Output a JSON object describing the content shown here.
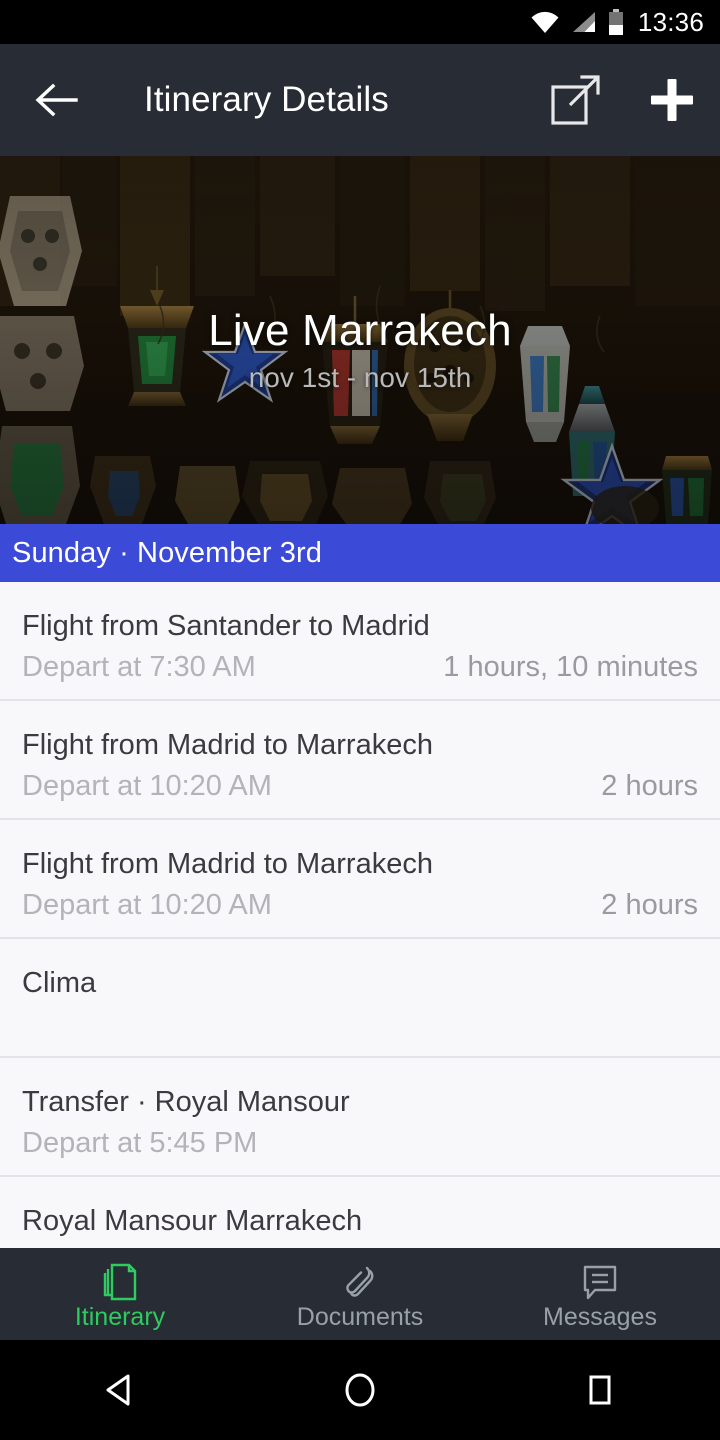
{
  "status_bar": {
    "time": "13:36",
    "icons": [
      "wifi-icon",
      "cellular-signal-icon",
      "battery-icon"
    ]
  },
  "app_bar": {
    "title": "Itinerary Details",
    "back_icon": "arrow-left-icon",
    "share_icon": "external-link-icon",
    "add_icon": "plus-icon"
  },
  "hero": {
    "title": "Live Marrakech",
    "subtitle": "nov 1st - nov 15th",
    "image_description": "moroccan-lanterns-photo"
  },
  "date_header": {
    "label": "Sunday · November 3rd",
    "color": "#3c4ad8"
  },
  "items": [
    {
      "title": "Flight from Santander to Madrid",
      "subtitle": "Depart at 7:30 AM",
      "meta": "1 hours, 10 minutes"
    },
    {
      "title": "Flight from Madrid to Marrakech",
      "subtitle": "Depart at 10:20 AM",
      "meta": "2 hours"
    },
    {
      "title": "Flight from Madrid to Marrakech",
      "subtitle": "Depart at 10:20 AM",
      "meta": "2 hours"
    },
    {
      "title": "Clima",
      "subtitle": "",
      "meta": ""
    },
    {
      "title": "Transfer · Royal Mansour",
      "subtitle": "Depart at 5:45 PM",
      "meta": ""
    },
    {
      "title": "Royal Mansour Marrakech",
      "subtitle": "",
      "meta": ""
    }
  ],
  "bottom_nav": {
    "active_color": "#2ecc5f",
    "inactive_color": "#9aa0a8",
    "tabs": [
      {
        "label": "Itinerary",
        "icon": "document-icon",
        "active": true
      },
      {
        "label": "Documents",
        "icon": "paperclip-icon",
        "active": false
      },
      {
        "label": "Messages",
        "icon": "chat-bubble-icon",
        "active": false
      }
    ]
  },
  "android_nav": {
    "back": "triangle-back-icon",
    "home": "circle-home-icon",
    "recents": "square-recents-icon"
  }
}
